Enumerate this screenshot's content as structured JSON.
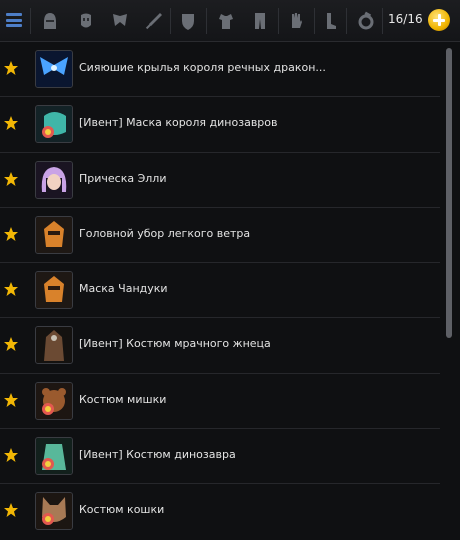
{
  "toolbar": {
    "menu_icon": "menu-icon",
    "slots": [
      {
        "icon": "helmet-icon"
      },
      {
        "icon": "mask-icon"
      },
      {
        "icon": "wings-icon"
      },
      {
        "icon": "sword-icon"
      },
      {
        "icon": "shield-icon"
      },
      {
        "icon": "armor-icon"
      },
      {
        "icon": "pants-icon"
      },
      {
        "icon": "gloves-icon"
      },
      {
        "icon": "boots-icon"
      },
      {
        "icon": "ring-icon"
      }
    ],
    "count": "16/16",
    "add_icon": "plus-icon"
  },
  "items": [
    {
      "name": "Сияюшие крылья короля речных дракон...",
      "icon": "wings-icon",
      "color": "#4aa3ff"
    },
    {
      "name": "[Ивент] Маска короля динозавров",
      "icon": "dino-mask-icon",
      "color": "#3fb6a8"
    },
    {
      "name": "Прическа Элли",
      "icon": "hair-icon",
      "color": "#c9a3e6"
    },
    {
      "name": "Головной убор легкого ветра",
      "icon": "headgear-icon",
      "color": "#d9822b"
    },
    {
      "name": "Маска Чандуки",
      "icon": "headgear-icon",
      "color": "#d9822b"
    },
    {
      "name": "[Ивент] Костюм мрачного жнеца",
      "icon": "reaper-icon",
      "color": "#6b4a33"
    },
    {
      "name": "Костюм мишки",
      "icon": "bear-icon",
      "color": "#9a5a2e"
    },
    {
      "name": "[Ивент] Костюм динозавра",
      "icon": "dino-suit-icon",
      "color": "#58b89a"
    },
    {
      "name": "Костюм кошки",
      "icon": "cat-icon",
      "color": "#a87a55"
    }
  ]
}
